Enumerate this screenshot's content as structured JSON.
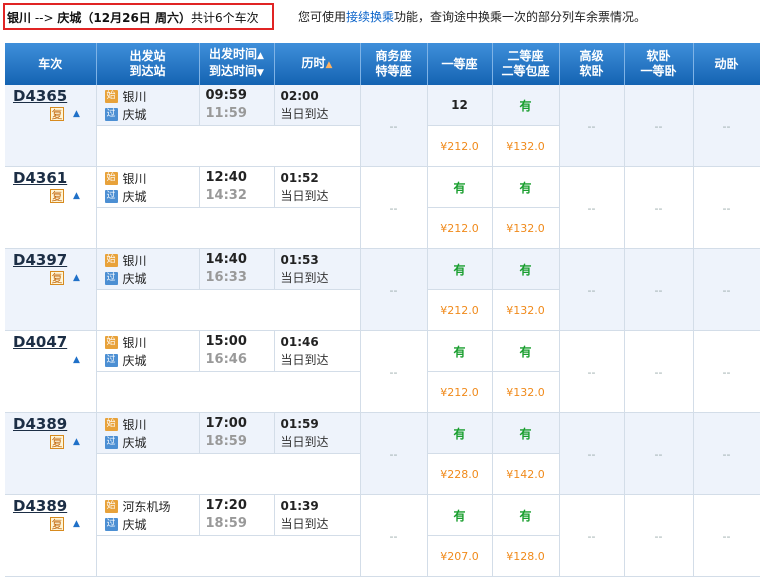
{
  "route": {
    "from": "银川",
    "arrow": "-->",
    "to": "庆城",
    "date": "（12月26日 周六）",
    "summary": "共计6个车次"
  },
  "hint": {
    "prefix": "您可使用",
    "link": "接续换乘",
    "suffix": "功能，查询途中换乘一次的部分列车余票情况。"
  },
  "headers": {
    "train": "车次",
    "station_top": "出发站",
    "station_bottom": "到达站",
    "time_top": "出发时间",
    "time_bottom": "到达时间",
    "duration": "历时",
    "business_top": "商务座",
    "business_bottom": "特等座",
    "first": "一等座",
    "second_top": "二等座",
    "second_bottom": "二等包座",
    "high_top": "高级",
    "high_bottom": "软卧",
    "soft_top": "软卧",
    "soft_bottom": "一等卧",
    "dongwo": "动卧"
  },
  "labels": {
    "fu": "复",
    "start_badge": "始",
    "pass_badge": "过",
    "up_arrow": "▲",
    "down_arrow": "▼",
    "dash": "--"
  },
  "trains": [
    {
      "no": "D4365",
      "show_fu": true,
      "from": "银川",
      "to": "庆城",
      "dep": "09:59",
      "arr": "11:59",
      "duration": "02:00",
      "arrive": "当日到达",
      "business": "--",
      "first": "12",
      "second": "有",
      "high": "--",
      "soft": "--",
      "dongwo": "--",
      "price_first": "¥212.0",
      "price_second": "¥132.0"
    },
    {
      "no": "D4361",
      "show_fu": true,
      "from": "银川",
      "to": "庆城",
      "dep": "12:40",
      "arr": "14:32",
      "duration": "01:52",
      "arrive": "当日到达",
      "business": "--",
      "first": "有",
      "second": "有",
      "high": "--",
      "soft": "--",
      "dongwo": "--",
      "price_first": "¥212.0",
      "price_second": "¥132.0"
    },
    {
      "no": "D4397",
      "show_fu": true,
      "from": "银川",
      "to": "庆城",
      "dep": "14:40",
      "arr": "16:33",
      "duration": "01:53",
      "arrive": "当日到达",
      "business": "--",
      "first": "有",
      "second": "有",
      "high": "--",
      "soft": "--",
      "dongwo": "--",
      "price_first": "¥212.0",
      "price_second": "¥132.0"
    },
    {
      "no": "D4047",
      "show_fu": false,
      "from": "银川",
      "to": "庆城",
      "dep": "15:00",
      "arr": "16:46",
      "duration": "01:46",
      "arrive": "当日到达",
      "business": "--",
      "first": "有",
      "second": "有",
      "high": "--",
      "soft": "--",
      "dongwo": "--",
      "price_first": "¥212.0",
      "price_second": "¥132.0"
    },
    {
      "no": "D4389",
      "show_fu": true,
      "from": "银川",
      "to": "庆城",
      "dep": "17:00",
      "arr": "18:59",
      "duration": "01:59",
      "arrive": "当日到达",
      "business": "--",
      "first": "有",
      "second": "有",
      "high": "--",
      "soft": "--",
      "dongwo": "--",
      "price_first": "¥228.0",
      "price_second": "¥142.0"
    },
    {
      "no": "D4389",
      "show_fu": true,
      "from": "河东机场",
      "to": "庆城",
      "dep": "17:20",
      "arr": "18:59",
      "duration": "01:39",
      "arrive": "当日到达",
      "business": "--",
      "first": "有",
      "second": "有",
      "high": "--",
      "soft": "--",
      "dongwo": "--",
      "price_first": "¥207.0",
      "price_second": "¥128.0"
    }
  ],
  "colors": {
    "header_bg": "#1a6ab8",
    "shade_row": "#eef3fb",
    "available": "#199e2e",
    "price": "#f08a1b",
    "highlight_border": "#e02424"
  }
}
